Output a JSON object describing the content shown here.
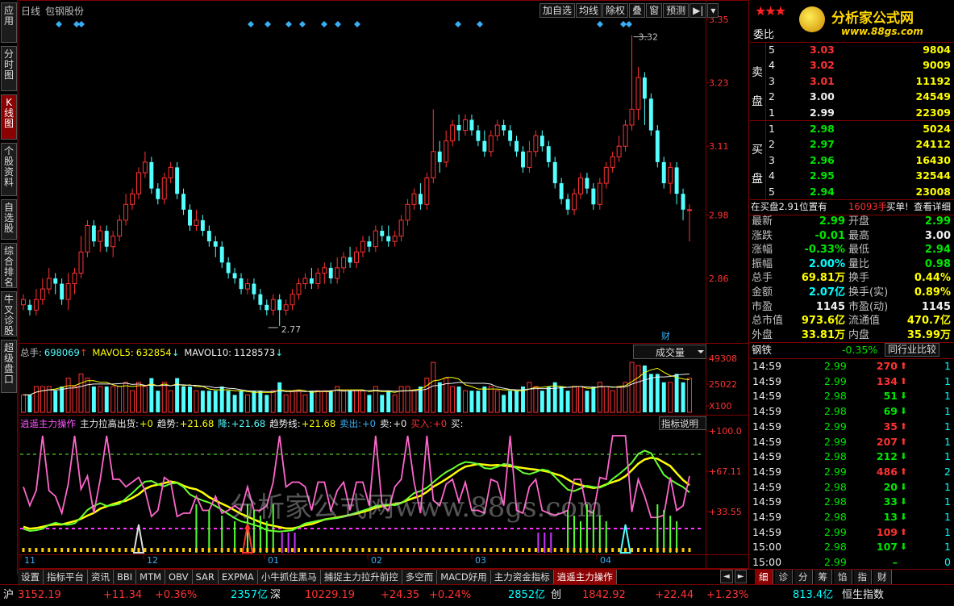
{
  "left_tabs": [
    "应用",
    "分时图",
    "K线图",
    "个股资料",
    "自选股",
    "综合排名",
    "牛叉诊股",
    "超级盘口"
  ],
  "left_tab_active": 2,
  "header": {
    "period": "日线",
    "stock_name": "包钢股份"
  },
  "top_buttons": [
    "加自选",
    "均线",
    "除权",
    "叠",
    "窗",
    "预测",
    "▶|",
    "▾"
  ],
  "kline": {
    "y_ticks": [
      "3.35",
      "3.23",
      "3.11",
      "2.98",
      "2.86"
    ],
    "high_label": "3.32",
    "low_label": "2.77",
    "cai_label": "财",
    "up_color": "#ff3232",
    "down_color": "#54ffff",
    "candles": [
      [
        2.81,
        2.82,
        2.83,
        2.8
      ],
      [
        2.81,
        2.8,
        2.82,
        2.79
      ],
      [
        2.8,
        2.82,
        2.84,
        2.79
      ],
      [
        2.82,
        2.84,
        2.86,
        2.81
      ],
      [
        2.84,
        2.86,
        2.88,
        2.83
      ],
      [
        2.86,
        2.85,
        2.87,
        2.83
      ],
      [
        2.85,
        2.82,
        2.86,
        2.81
      ],
      [
        2.82,
        2.85,
        2.87,
        2.8
      ],
      [
        2.85,
        2.87,
        2.88,
        2.83
      ],
      [
        2.87,
        2.91,
        2.94,
        2.86
      ],
      [
        2.91,
        2.96,
        2.97,
        2.9
      ],
      [
        2.96,
        2.93,
        2.97,
        2.92
      ],
      [
        2.93,
        2.95,
        2.96,
        2.91
      ],
      [
        2.95,
        2.92,
        2.96,
        2.91
      ],
      [
        2.92,
        2.94,
        2.95,
        2.9
      ],
      [
        2.94,
        2.97,
        2.98,
        2.93
      ],
      [
        2.97,
        3.0,
        3.02,
        2.96
      ],
      [
        3.0,
        3.02,
        3.03,
        2.99
      ],
      [
        3.02,
        3.06,
        3.07,
        3.01
      ],
      [
        3.06,
        3.08,
        3.1,
        3.05
      ],
      [
        3.08,
        3.03,
        3.09,
        3.02
      ],
      [
        3.03,
        3.01,
        3.04,
        3.0
      ],
      [
        3.01,
        3.05,
        3.06,
        3.0
      ],
      [
        3.05,
        3.07,
        3.08,
        3.04
      ],
      [
        3.07,
        3.02,
        3.08,
        3.01
      ],
      [
        3.02,
        2.99,
        3.03,
        2.98
      ],
      [
        2.99,
        2.96,
        3.0,
        2.95
      ],
      [
        2.96,
        2.97,
        2.99,
        2.95
      ],
      [
        2.97,
        2.95,
        2.98,
        2.94
      ],
      [
        2.95,
        2.93,
        2.96,
        2.92
      ],
      [
        2.93,
        2.92,
        2.94,
        2.9
      ],
      [
        2.92,
        2.89,
        2.93,
        2.88
      ],
      [
        2.89,
        2.87,
        2.9,
        2.86
      ],
      [
        2.87,
        2.86,
        2.88,
        2.85
      ],
      [
        2.86,
        2.84,
        2.87,
        2.83
      ],
      [
        2.84,
        2.85,
        2.86,
        2.83
      ],
      [
        2.85,
        2.83,
        2.86,
        2.82
      ],
      [
        2.83,
        2.81,
        2.84,
        2.8
      ],
      [
        2.81,
        2.8,
        2.82,
        2.79
      ],
      [
        2.8,
        2.82,
        2.83,
        2.79
      ],
      [
        2.82,
        2.8,
        2.83,
        2.77
      ],
      [
        2.8,
        2.81,
        2.82,
        2.79
      ],
      [
        2.81,
        2.83,
        2.84,
        2.8
      ],
      [
        2.83,
        2.85,
        2.86,
        2.82
      ],
      [
        2.85,
        2.86,
        2.87,
        2.84
      ],
      [
        2.86,
        2.85,
        2.88,
        2.84
      ],
      [
        2.85,
        2.87,
        2.88,
        2.84
      ],
      [
        2.87,
        2.88,
        2.89,
        2.85
      ],
      [
        2.88,
        2.86,
        2.89,
        2.85
      ],
      [
        2.86,
        2.88,
        2.9,
        2.85
      ],
      [
        2.88,
        2.9,
        2.91,
        2.87
      ],
      [
        2.9,
        2.89,
        2.92,
        2.88
      ],
      [
        2.89,
        2.91,
        2.92,
        2.88
      ],
      [
        2.91,
        2.93,
        2.94,
        2.9
      ],
      [
        2.93,
        2.92,
        2.94,
        2.91
      ],
      [
        2.92,
        2.95,
        2.96,
        2.91
      ],
      [
        2.95,
        2.94,
        2.96,
        2.93
      ],
      [
        2.94,
        2.93,
        2.96,
        2.92
      ],
      [
        2.93,
        2.94,
        2.95,
        2.92
      ],
      [
        2.94,
        2.97,
        2.98,
        2.93
      ],
      [
        2.97,
        3.0,
        3.01,
        2.96
      ],
      [
        3.0,
        3.02,
        3.03,
        2.99
      ],
      [
        3.02,
        3.0,
        3.04,
        2.99
      ],
      [
        3.0,
        3.05,
        3.06,
        2.99
      ],
      [
        3.05,
        3.1,
        3.18,
        3.04
      ],
      [
        3.1,
        3.08,
        3.12,
        3.06
      ],
      [
        3.08,
        3.12,
        3.14,
        3.07
      ],
      [
        3.12,
        3.15,
        3.16,
        3.11
      ],
      [
        3.15,
        3.14,
        3.17,
        3.12
      ],
      [
        3.14,
        3.16,
        3.17,
        3.13
      ],
      [
        3.16,
        3.14,
        3.17,
        3.13
      ],
      [
        3.14,
        3.12,
        3.15,
        3.11
      ],
      [
        3.12,
        3.1,
        3.14,
        3.09
      ],
      [
        3.1,
        3.13,
        3.14,
        3.09
      ],
      [
        3.13,
        3.15,
        3.16,
        3.12
      ],
      [
        3.15,
        3.14,
        3.16,
        3.13
      ],
      [
        3.14,
        3.12,
        3.15,
        3.11
      ],
      [
        3.12,
        3.1,
        3.13,
        3.09
      ],
      [
        3.1,
        3.07,
        3.11,
        3.06
      ],
      [
        3.07,
        3.1,
        3.12,
        3.06
      ],
      [
        3.1,
        3.13,
        3.14,
        3.09
      ],
      [
        3.13,
        3.11,
        3.14,
        3.1
      ],
      [
        3.11,
        3.08,
        3.12,
        3.07
      ],
      [
        3.08,
        3.04,
        3.09,
        3.03
      ],
      [
        3.04,
        3.01,
        3.05,
        3.0
      ],
      [
        3.01,
        2.99,
        3.02,
        2.98
      ],
      [
        2.99,
        3.02,
        3.03,
        2.98
      ],
      [
        3.02,
        3.05,
        3.06,
        3.01
      ],
      [
        3.05,
        3.03,
        3.06,
        3.02
      ],
      [
        3.03,
        3.0,
        3.04,
        2.99
      ],
      [
        3.0,
        3.04,
        3.05,
        2.99
      ],
      [
        3.04,
        3.07,
        3.08,
        3.03
      ],
      [
        3.07,
        3.09,
        3.1,
        3.06
      ],
      [
        3.09,
        3.11,
        3.13,
        3.08
      ],
      [
        3.11,
        3.15,
        3.16,
        3.1
      ],
      [
        3.15,
        3.18,
        3.32,
        3.14
      ],
      [
        3.18,
        3.24,
        3.26,
        3.16
      ],
      [
        3.24,
        3.2,
        3.25,
        3.15
      ],
      [
        3.2,
        3.14,
        3.21,
        3.13
      ],
      [
        3.14,
        3.08,
        3.15,
        3.07
      ],
      [
        3.08,
        3.04,
        3.09,
        3.03
      ],
      [
        3.04,
        3.07,
        3.08,
        3.02
      ],
      [
        3.07,
        3.02,
        3.08,
        3.0
      ],
      [
        3.02,
        2.99,
        3.03,
        2.97
      ],
      [
        2.99,
        2.99,
        3.0,
        2.93
      ]
    ]
  },
  "volume": {
    "total_label": "总手:",
    "total_value": "698069",
    "mavol5_label": "MAVOL5:",
    "mavol5_value": "632854",
    "mavol10_label": "MAVOL10:",
    "mavol10_value": "1128573",
    "up_arrow": "↑",
    "down_arrow": "↓",
    "dropdown": "成交量",
    "y_ticks": [
      "49308",
      "25022",
      "X100"
    ]
  },
  "indicator": {
    "title": "逍遥主力操作",
    "items": [
      "主力拉高出货:",
      "+0",
      "趋势:",
      "+21.68",
      "降:",
      "+21.68",
      "趋势线:",
      "+21.68",
      "卖出:",
      "+0",
      "卖:",
      "+0",
      "买入:",
      "+0",
      "买:"
    ],
    "button": "指标说明",
    "y_ticks": [
      "+100.0",
      "+67.11",
      "+33.55"
    ]
  },
  "watermark": "分析家公式网www.88gs.com",
  "x_labels": [
    "11",
    "12",
    "01",
    "02",
    "03",
    "04"
  ],
  "bottom_tabs": [
    "设置",
    "指标平台",
    "资讯",
    "BBI",
    "MTM",
    "OBV",
    "SAR",
    "EXPMA",
    "小牛抓住黑马",
    "捕捉主力拉升前控",
    "多空而",
    "MACD好用",
    "主力资金指标",
    "逍遥主力操作"
  ],
  "bottom_active": 13,
  "nav_arrows": [
    "◄",
    "►"
  ],
  "right": {
    "logo": "分析家公式网",
    "logo_url": "www.88gs.com",
    "stars": "★★★",
    "weibi": "委比",
    "sell_label": "卖盘",
    "buy_label": "买盘",
    "sells": [
      [
        "5",
        "3.03",
        "9804"
      ],
      [
        "4",
        "3.02",
        "9009"
      ],
      [
        "3",
        "3.01",
        "11192"
      ],
      [
        "2",
        "3.00",
        "24549"
      ],
      [
        "1",
        "2.99",
        "22309"
      ]
    ],
    "buys": [
      [
        "1",
        "2.98",
        "5024"
      ],
      [
        "2",
        "2.97",
        "24112"
      ],
      [
        "3",
        "2.96",
        "16430"
      ],
      [
        "4",
        "2.95",
        "32544"
      ],
      [
        "5",
        "2.94",
        "23008"
      ]
    ],
    "position_text": "在买盘2.91位置有",
    "position_qty": "16093手",
    "position_action": "买单!",
    "position_detail": "查看详细",
    "quote": [
      [
        "最新",
        "2.99",
        "开盘",
        "2.99"
      ],
      [
        "涨跌",
        "-0.01",
        "最高",
        "3.00"
      ],
      [
        "涨幅",
        "-0.33%",
        "最低",
        "2.94"
      ],
      [
        "振幅",
        "2.00%",
        "量比",
        "0.98"
      ],
      [
        "总手",
        "69.81万",
        "换手",
        "0.44%"
      ],
      [
        "金额",
        "2.07亿",
        "换手(实)",
        "0.89%"
      ],
      [
        "市盈",
        "1145",
        "市盈(动)",
        "1145"
      ],
      [
        "总市值",
        "973.6亿",
        "流通值",
        "470.7亿"
      ],
      [
        "外盘",
        "33.81万",
        "内盘",
        "35.99万"
      ]
    ],
    "industry": "钢铁",
    "industry_pct": "-0.35%",
    "industry_btn": "同行业比较",
    "ticks": [
      [
        "14:59",
        "2.99",
        "270",
        "up",
        "1"
      ],
      [
        "14:59",
        "2.99",
        "134",
        "up",
        "1"
      ],
      [
        "14:59",
        "2.98",
        "51",
        "down",
        "1"
      ],
      [
        "14:59",
        "2.98",
        "69",
        "down",
        "1"
      ],
      [
        "14:59",
        "2.99",
        "35",
        "up",
        "1"
      ],
      [
        "14:59",
        "2.99",
        "207",
        "up",
        "1"
      ],
      [
        "14:59",
        "2.98",
        "212",
        "down",
        "1"
      ],
      [
        "14:59",
        "2.99",
        "486",
        "up",
        "2"
      ],
      [
        "14:59",
        "2.98",
        "20",
        "down",
        "1"
      ],
      [
        "14:59",
        "2.98",
        "33",
        "down",
        "1"
      ],
      [
        "14:59",
        "2.98",
        "13",
        "down",
        "1"
      ],
      [
        "14:59",
        "2.99",
        "109",
        "up",
        "1"
      ],
      [
        "15:00",
        "2.98",
        "107",
        "down",
        "1"
      ],
      [
        "15:00",
        "2.99",
        "–",
        "none",
        "0"
      ]
    ],
    "tabs": [
      "细",
      "诊",
      "分",
      "筹",
      "馅",
      "指",
      "财"
    ]
  },
  "status": {
    "sh_label": "沪",
    "sh_index": "3152.19",
    "sh_chg": "+11.34",
    "sh_pct": "+0.36%",
    "sh_amt": "2357亿",
    "sz_label": "深",
    "sz_index": "10229.19",
    "sz_chg": "+24.35",
    "sz_pct": "+0.24%",
    "sz_amt": "2852亿",
    "cy_label": "创",
    "cy_index": "1842.92",
    "cy_chg": "+22.44",
    "cy_pct": "+1.23%",
    "cy_amt": "813.4亿",
    "hs_label": "恒生指数"
  }
}
